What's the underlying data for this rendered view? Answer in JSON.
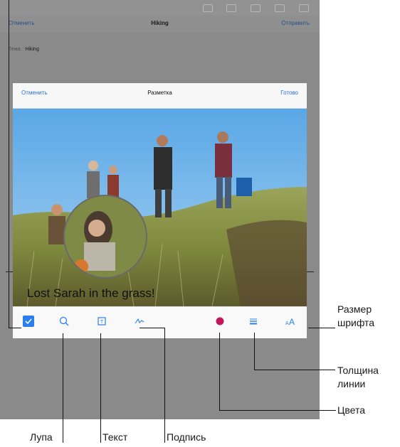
{
  "mail": {
    "cancel": "Отменить",
    "title": "Hiking",
    "send": "Отправить",
    "subject_label": "Тема:",
    "subject_value": "Hiking"
  },
  "markup": {
    "cancel": "Отменить",
    "title": "Разметка",
    "done": "Готово"
  },
  "photo": {
    "caption": "Lost Sarah in the grass!"
  },
  "toolbar": {
    "items": [
      {
        "icon": "markup-checkmark-icon",
        "color": "#2b7ef0"
      },
      {
        "icon": "magnifier-icon",
        "color": "#2b7ef0"
      },
      {
        "icon": "text-box-icon",
        "color": "#2b7ef0"
      },
      {
        "icon": "signature-icon",
        "color": "#2b7ef0"
      },
      {
        "icon": "color-dot-icon",
        "color": "#c2185b"
      },
      {
        "icon": "line-thickness-icon",
        "color": "#2b7ef0"
      },
      {
        "icon": "font-size-icon",
        "color": "#2b7ef0"
      }
    ]
  },
  "callouts": {
    "font_size": "Размер\nшрифта",
    "line_width": "Толщина\nлинии",
    "colors": "Цвета",
    "magnifier": "Лупа",
    "text": "Текст",
    "signature": "Подпись"
  }
}
